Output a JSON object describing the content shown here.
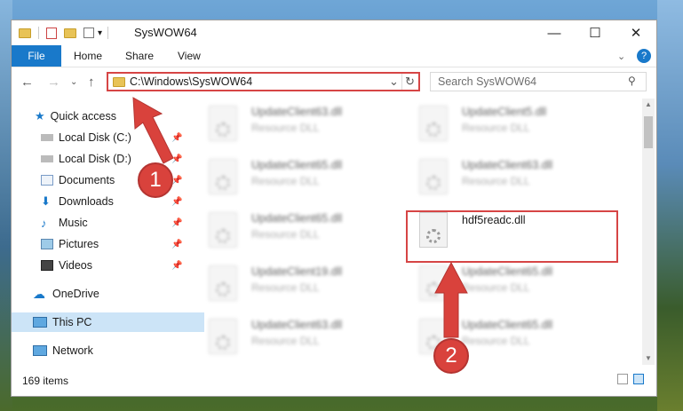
{
  "window": {
    "title": "SysWOW64",
    "minimize": "—",
    "maximize": "☐",
    "close": "✕"
  },
  "ribbon": {
    "file": "File",
    "tabs": [
      "Home",
      "Share",
      "View"
    ],
    "help": "?"
  },
  "nav": {
    "back": "←",
    "forward": "→",
    "up": "↑",
    "address": "C:\\Windows\\SysWOW64",
    "dropdown": "⌄",
    "refresh": "↻",
    "search_placeholder": "Search SysWOW64"
  },
  "sidebar": {
    "items": [
      {
        "label": "Quick access"
      },
      {
        "label": "Local Disk (C:)"
      },
      {
        "label": "Local Disk (D:)"
      },
      {
        "label": "Documents"
      },
      {
        "label": "Downloads"
      },
      {
        "label": "Music"
      },
      {
        "label": "Pictures"
      },
      {
        "label": "Videos"
      },
      {
        "label": "OneDrive"
      },
      {
        "label": "This PC"
      },
      {
        "label": "Network"
      }
    ]
  },
  "files": [
    {
      "name": "UpdateClient63.dll",
      "type": "Resource DLL"
    },
    {
      "name": "UpdateClient5.dll",
      "type": "Resource DLL"
    },
    {
      "name": "UpdateClient65.dll",
      "type": "Resource DLL"
    },
    {
      "name": "UpdateClient63.dll",
      "type": "Resource DLL"
    },
    {
      "name": "UpdateClient65.dll",
      "type": "Resource DLL"
    },
    {
      "name": "hdf5readc.dll",
      "type": ""
    },
    {
      "name": "UpdateClient19.dll",
      "type": "Resource DLL"
    },
    {
      "name": "UpdateClient65.dll",
      "type": "Resource DLL"
    },
    {
      "name": "UpdateClient63.dll",
      "type": "Resource DLL"
    },
    {
      "name": "UpdateClient65.dll",
      "type": "Resource DLL"
    }
  ],
  "status": {
    "count": "169 items"
  },
  "annotations": {
    "step1": "1",
    "step2": "2",
    "highlight_color": "#d64545"
  }
}
